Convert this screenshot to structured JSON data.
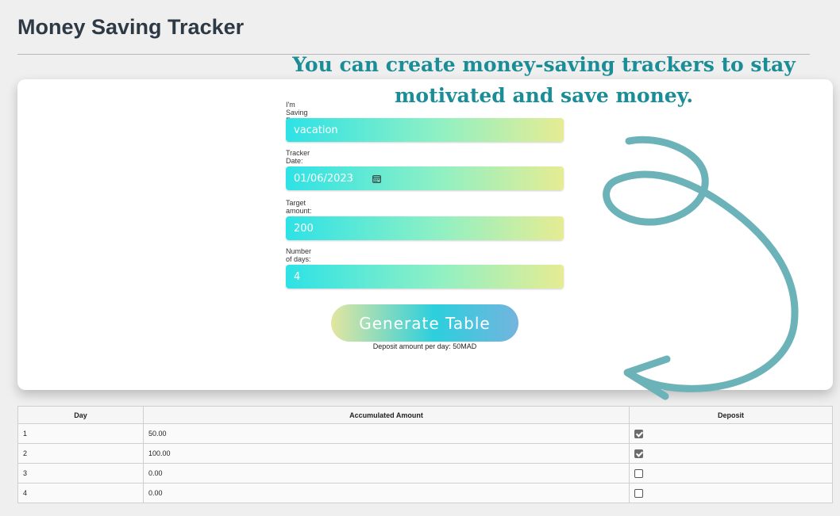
{
  "page": {
    "title": "Money Saving Tracker"
  },
  "annotation": {
    "line1": "You can create money-saving trackers to stay",
    "line2": "motivated and save money."
  },
  "form": {
    "saving_for_label": "I'm Saving For ...:",
    "saving_for_value": "vacation",
    "tracker_date_label": "Tracker Date:",
    "tracker_date_value": "01/06/2023",
    "target_amount_label": "Target amount:",
    "target_amount_value": "200",
    "days_label": "Number of days:",
    "days_value": "4",
    "generate_label": "Generate Table",
    "deposit_note": "Deposit amount per day: 50MAD"
  },
  "table": {
    "headers": [
      "Day",
      "Accumulated Amount",
      "Deposit"
    ],
    "rows": [
      {
        "day": "1",
        "amount": "50.00",
        "deposit": true
      },
      {
        "day": "2",
        "amount": "100.00",
        "deposit": true
      },
      {
        "day": "3",
        "amount": "0.00",
        "deposit": false
      },
      {
        "day": "4",
        "amount": "0.00",
        "deposit": false
      }
    ]
  },
  "colors": {
    "accent": "#1b8d97",
    "field_gradient_start": "#2de2e6",
    "field_gradient_end": "#e6ec93"
  },
  "icons": {
    "date_picker": "calendar-icon"
  }
}
